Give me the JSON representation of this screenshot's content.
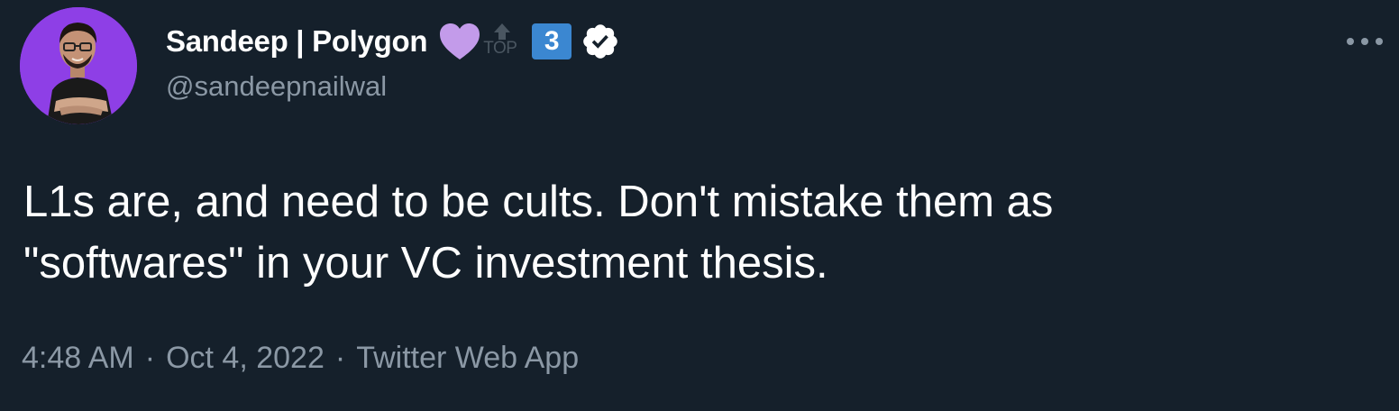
{
  "tweet": {
    "author": {
      "display_name": "Sandeep | Polygon",
      "handle": "@sandeepnailwal",
      "avatar": "avatar-photo-purple-background",
      "badges": {
        "heart": "purple-heart-emoji",
        "top_label": "TOP",
        "keycap_number": "3",
        "verified": "verified-badge-icon"
      }
    },
    "text_line1": "L1s are, and need to be cults. Don't mistake them as",
    "text_line2": "\"softwares\" in your VC investment thesis.",
    "meta": {
      "time": "4:48 AM",
      "separator": "·",
      "date": "Oct 4, 2022",
      "source": "Twitter Web App"
    },
    "more_menu": "more-options-icon"
  },
  "colors": {
    "background": "#15202b",
    "primary_text": "#ffffff",
    "secondary_text": "#8b98a5",
    "avatar_bg": "#8e3fe6",
    "heart": "#c39bea",
    "keycap": "#3b87d1"
  }
}
